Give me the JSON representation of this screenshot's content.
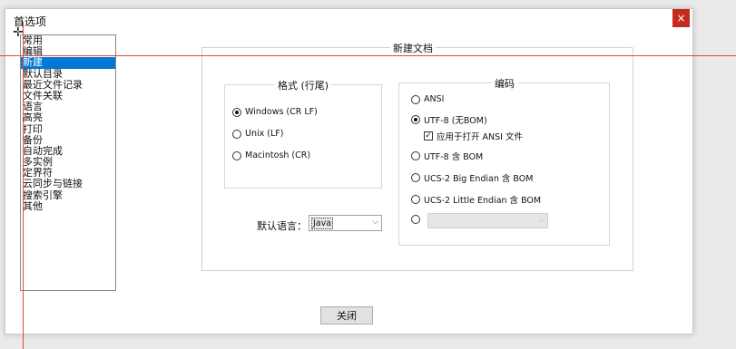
{
  "window": {
    "title": "首选项",
    "close_glyph": "×"
  },
  "sidebar": {
    "items": [
      "常用",
      "编辑",
      "新建",
      "默认目录",
      "最近文件记录",
      "文件关联",
      "语言",
      "高亮",
      "打印",
      "备份",
      "自动完成",
      "多实例",
      "定界符",
      "云同步与链接",
      "搜索引擎",
      "其他"
    ],
    "selected_index": 2
  },
  "main": {
    "section_title": "新建文档",
    "format_group": {
      "title": "格式 (行尾)",
      "options": [
        "Windows (CR LF)",
        "Unix (LF)",
        "Macintosh (CR)"
      ],
      "selected_index": 0
    },
    "encoding_group": {
      "title": "编码",
      "options": [
        "ANSI",
        "UTF-8 (无BOM)",
        "UTF-8 含 BOM",
        "UCS-2 Big Endian 含 BOM",
        "UCS-2 Little Endian 含 BOM"
      ],
      "selected_index": 1,
      "apply_checkbox_label": "应用于打开 ANSI 文件",
      "apply_checkbox_checked": true
    },
    "default_language": {
      "label": "默认语言：",
      "value": "Java"
    },
    "close_button": "关闭"
  },
  "colors": {
    "accent": "#0078d7",
    "close_red": "#c42b1c",
    "guide_red": "#e04a3a"
  }
}
